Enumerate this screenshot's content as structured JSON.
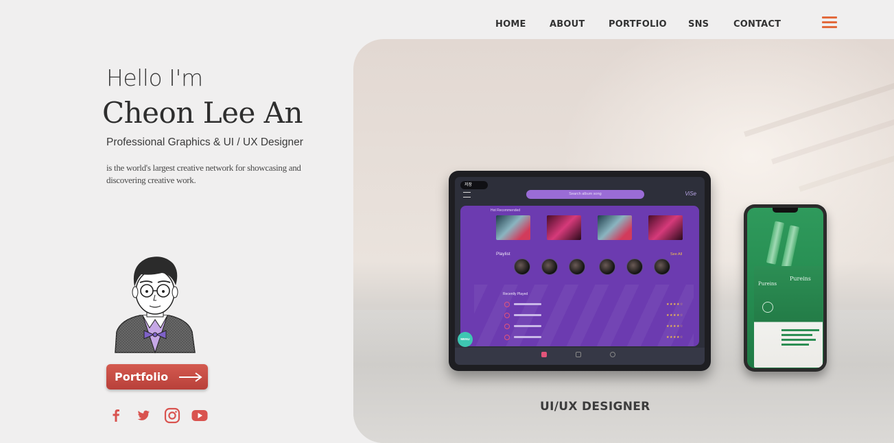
{
  "nav": {
    "items": [
      {
        "label": "HOME"
      },
      {
        "label": "ABOUT"
      },
      {
        "label": "PORTFOLIO"
      },
      {
        "label": "SNS"
      },
      {
        "label": "CONTACT"
      }
    ],
    "menu_icon": "hamburger-icon",
    "accent_color": "#e26a3c"
  },
  "intro": {
    "greeting": "Hello I'm",
    "name": "Cheon Lee An",
    "role": "Professional Graphics & UI / UX Designer",
    "description": "is the world's largest creative network for showcasing and discovering creative work.",
    "portfolio_button": "Portfolio",
    "button_color": "#c84a43"
  },
  "social": [
    {
      "icon": "facebook-icon"
    },
    {
      "icon": "twitter-icon"
    },
    {
      "icon": "instagram-icon"
    },
    {
      "icon": "youtube-icon"
    }
  ],
  "hero": {
    "caption": "UI/UX DESIGNER"
  },
  "tablet_app": {
    "badge": "저장",
    "search_placeholder": "Search album song",
    "logo": "ViSe",
    "section_recommended": "Hot Recommended",
    "section_playlist": "Playlist",
    "see_all": "See All",
    "section_recent": "Recently Played",
    "fab": "MENU"
  },
  "phone_app": {
    "brand": "Pureins"
  }
}
